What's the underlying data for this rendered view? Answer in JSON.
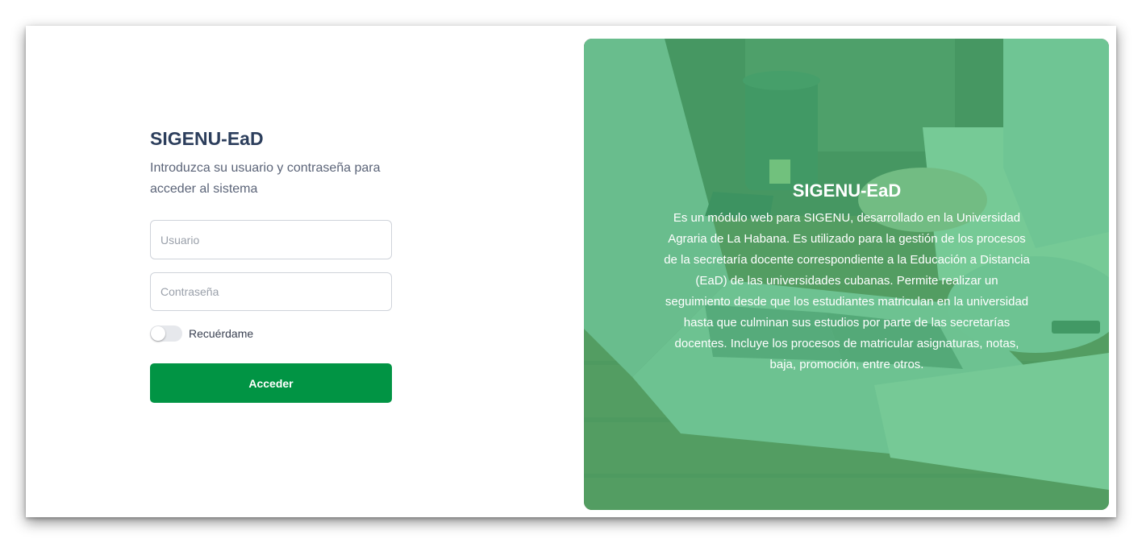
{
  "login": {
    "title": "SIGENU-EaD",
    "subtitle": "Introduzca su usuario y contraseña para acceder al sistema",
    "username_placeholder": "Usuario",
    "password_placeholder": "Contraseña",
    "remember_label": "Recuérdame",
    "remember_checked": false,
    "submit_label": "Acceder"
  },
  "hero": {
    "title": "SIGENU-EaD",
    "description": "Es un módulo web para SIGENU, desarrollado en la Universidad Agraria de La Habana. Es utilizado para la gestión de los procesos de la secretaría docente correspondiente a la Educación a Distancia (EaD) de las universidades cubanas. Permite realizar un seguimiento desde que los estudiantes matriculan en la universidad hasta que culminan sus estudios por parte de las secretarías docentes. Incluye los procesos de matricular asignaturas, notas, baja, promoción, entre otros."
  },
  "colors": {
    "primary_green": "#019444",
    "title_navy": "#2c3e5c",
    "hero_tint": "#49be78"
  }
}
